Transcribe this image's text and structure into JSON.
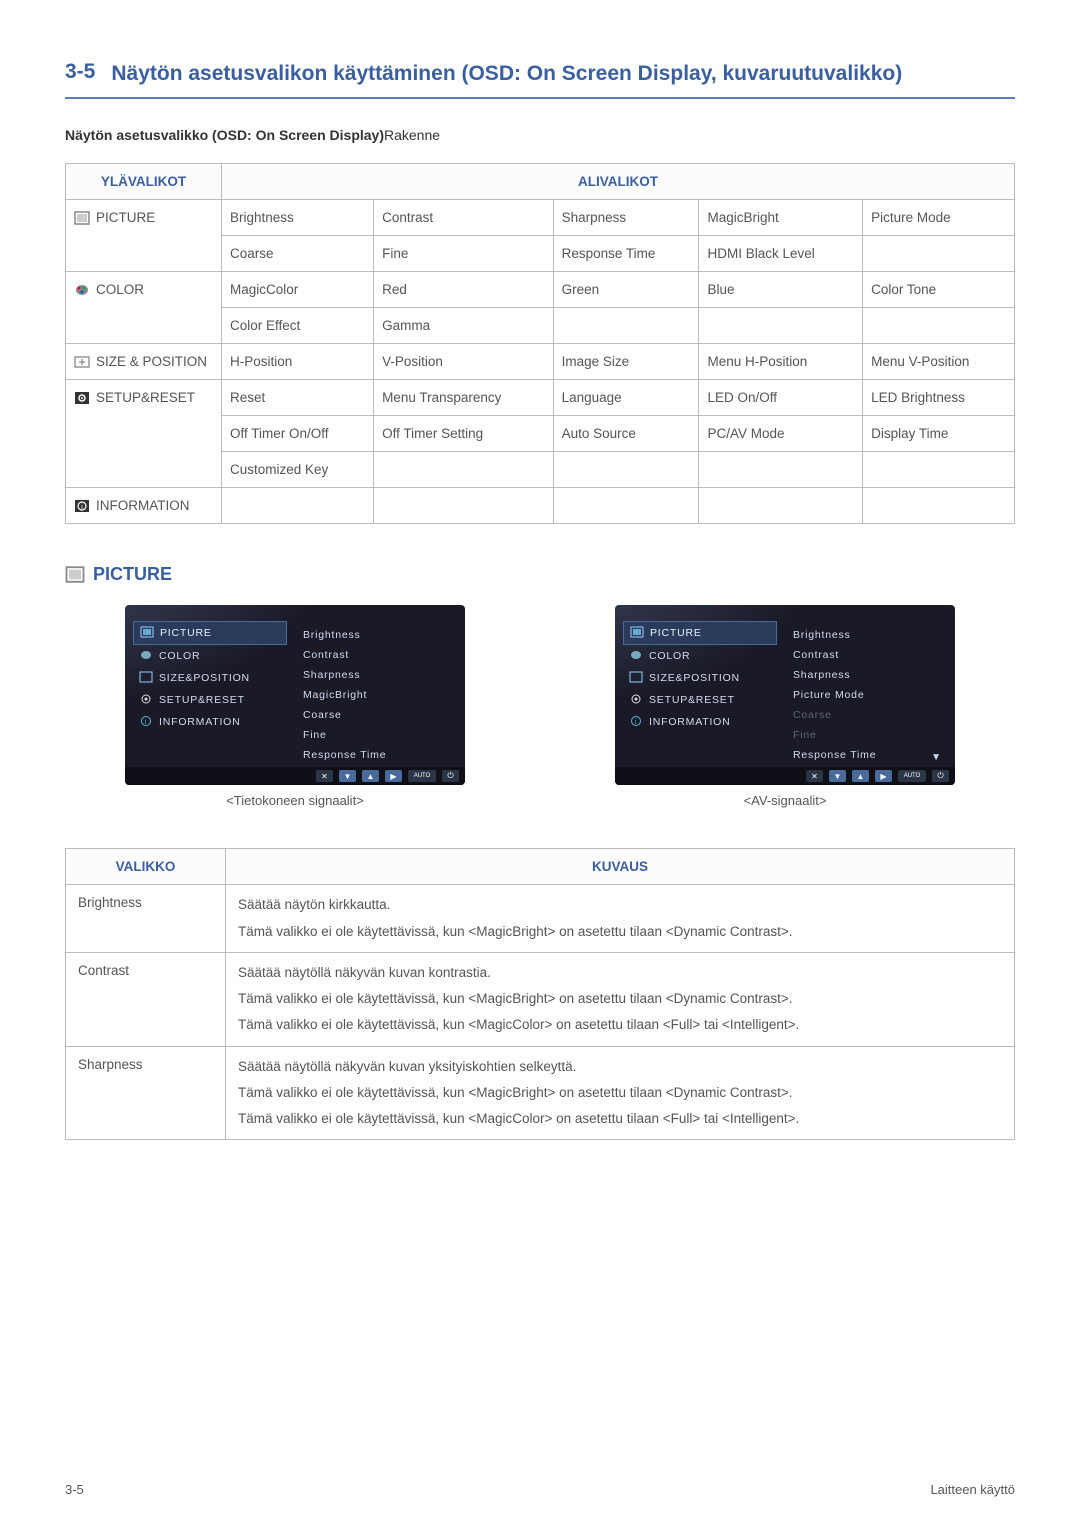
{
  "page": {
    "section_num": "3-5",
    "title": "Näytön asetusvalikon käyttäminen (OSD: On Screen Display, kuvaruutuvalikko)",
    "subheading_bold": "Näytön asetusvalikko (OSD: On Screen Display)",
    "subheading_normal": "Rakenne"
  },
  "struct_header": {
    "top": "YLÄVALIKOT",
    "sub": "ALIVALIKOT"
  },
  "struct": {
    "picture": {
      "label": "PICTURE",
      "row1": [
        "Brightness",
        "Contrast",
        "Sharpness",
        "MagicBright",
        "Picture Mode"
      ],
      "row2": [
        "Coarse",
        "Fine",
        "Response Time",
        "HDMI Black Level",
        ""
      ]
    },
    "color": {
      "label": "COLOR",
      "row1": [
        "MagicColor",
        "Red",
        "Green",
        "Blue",
        "Color Tone"
      ],
      "row2": [
        "Color Effect",
        "Gamma",
        "",
        "",
        ""
      ]
    },
    "size": {
      "label": "SIZE & POSITION",
      "row1": [
        "H-Position",
        "V-Position",
        "Image Size",
        "Menu H-Position",
        "Menu V-Position"
      ]
    },
    "setup": {
      "label": "SETUP&RESET",
      "row1": [
        "Reset",
        "Menu Transparency",
        "Language",
        "LED On/Off",
        "LED Brightness"
      ],
      "row2": [
        "Off Timer On/Off",
        "Off Timer Setting",
        "Auto Source",
        "PC/AV Mode",
        "Display Time"
      ],
      "row3": [
        "Customized Key",
        "",
        "",
        "",
        ""
      ]
    },
    "info": {
      "label": "INFORMATION",
      "row1": [
        "",
        "",
        "",
        "",
        ""
      ]
    }
  },
  "section_picture": "PICTURE",
  "osd": {
    "menu": {
      "picture": "PICTURE",
      "color": "COLOR",
      "size": "SIZE&POSITION",
      "setup": "SETUP&RESET",
      "info": "INFORMATION"
    },
    "pc_items": [
      "Brightness",
      "Contrast",
      "Sharpness",
      "MagicBright",
      "Coarse",
      "Fine",
      "Response Time"
    ],
    "av_items": [
      {
        "t": "Brightness",
        "dim": false
      },
      {
        "t": "Contrast",
        "dim": false
      },
      {
        "t": "Sharpness",
        "dim": false
      },
      {
        "t": "Picture Mode",
        "dim": false
      },
      {
        "t": "Coarse",
        "dim": true
      },
      {
        "t": "Fine",
        "dim": true
      },
      {
        "t": "Response Time",
        "dim": false
      }
    ],
    "bottom_auto": "AUTO",
    "pc_caption": "<Tietokoneen signaalit>",
    "av_caption": "<AV-signaalit>"
  },
  "desc_header": {
    "menu": "VALIKKO",
    "desc": "KUVAUS"
  },
  "desc": [
    {
      "name": "Brightness",
      "lines": [
        "Säätää näytön kirkkautta.",
        "Tämä valikko ei ole käytettävissä, kun <MagicBright> on asetettu tilaan <Dynamic Contrast>."
      ]
    },
    {
      "name": "Contrast",
      "lines": [
        "Säätää näytöllä näkyvän kuvan kontrastia.",
        "Tämä valikko ei ole käytettävissä, kun <MagicBright> on asetettu tilaan <Dynamic Contrast>.",
        "Tämä valikko ei ole käytettävissä, kun <MagicColor> on asetettu tilaan <Full> tai <Intelligent>."
      ]
    },
    {
      "name": "Sharpness",
      "lines": [
        "Säätää näytöllä näkyvän kuvan yksityiskohtien selkeyttä.",
        "Tämä valikko ei ole käytettävissä, kun <MagicBright> on asetettu tilaan <Dynamic Contrast>.",
        "Tämä valikko ei ole käytettävissä, kun <MagicColor> on asetettu tilaan <Full> tai <Intelligent>."
      ]
    }
  ],
  "footer": {
    "left": "3-5",
    "right": "Laitteen käyttö"
  }
}
